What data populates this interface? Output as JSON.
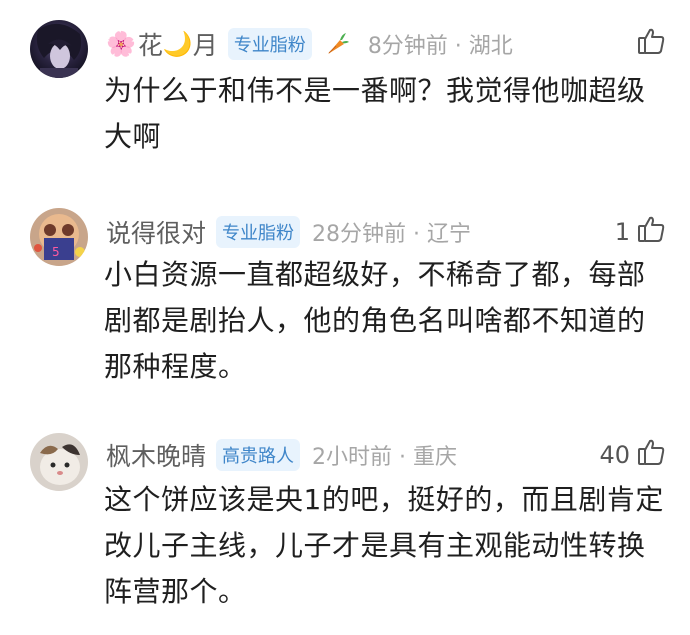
{
  "comments": [
    {
      "username_prefix": "🌸",
      "username": "花",
      "username_moon": "🌙",
      "username_suffix": "月",
      "badge": "专业脂粉",
      "time_location": "8分钟前 · 湖北",
      "likes": "",
      "content": "为什么于和伟不是一番啊？我觉得他咖超级大啊"
    },
    {
      "username": "说得很对",
      "badge": "专业脂粉",
      "time_location": "28分钟前 · 辽宁",
      "likes": "1",
      "content": "小白资源一直都超级好，不稀奇了都，每部剧都是剧抬人，他的角色名叫啥都不知道的那种程度。"
    },
    {
      "username": "枫木晚晴",
      "badge": "高贵路人",
      "time_location": "2小时前 · 重庆",
      "likes": "40",
      "content": "这个饼应该是央1的吧，挺好的，而且剧肯定改儿子主线，儿子才是具有主观能动性转换阵营那个。"
    }
  ],
  "icons": {
    "like": "thumbs-up-icon",
    "carrot": "carrot-icon"
  },
  "colors": {
    "badge_bg": "#e8f3fd",
    "badge_text": "#3f86c9",
    "meta": "#a6a6a6",
    "username": "#5f5f5f",
    "content": "#1f1f1f"
  }
}
